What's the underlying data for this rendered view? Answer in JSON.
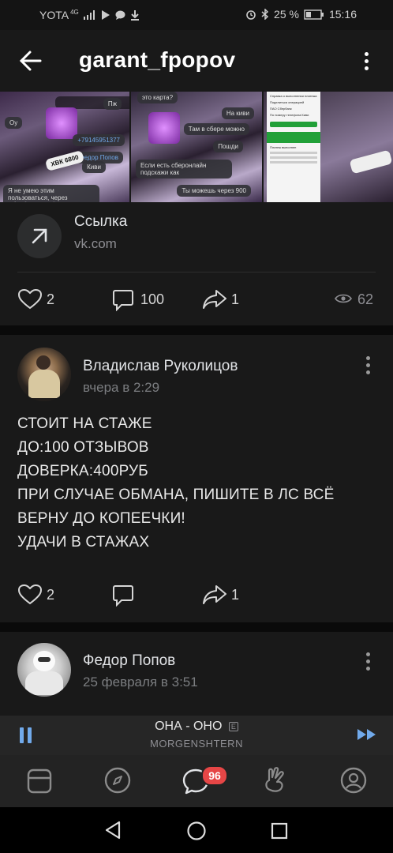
{
  "status_bar": {
    "carrier": "YOTA",
    "network": "4G",
    "battery": "25 %",
    "time": "15:16"
  },
  "header": {
    "title": "garant_fpopov",
    "back_icon": "arrow-left-icon",
    "more_icon": "more-vertical-icon"
  },
  "gallery": {
    "image1": {
      "bubbles": [
        "Пж",
        "Оу",
        "+79145951377",
        "Федор Попов",
        "Киви",
        "Я не умею этим пользоваться, через Сбербанк онлайн могу?"
      ],
      "plate": "ХВК 6800"
    },
    "image2": {
      "bubbles": [
        "это карта?",
        "На киви",
        "Там в сбере можно",
        "Пошди",
        "Если есть сберонлайн подскажи как",
        "Ты можешь через 900"
      ]
    },
    "image3": {
      "rows": [
        "Справка о выполнении платежа",
        "Поделиться операцией",
        "ПАО Сбербанк",
        "По номеру телефона Киви",
        "Платеж выполнен"
      ]
    }
  },
  "link": {
    "title": "Ссылка",
    "domain": "vk.com",
    "icon": "arrow-up-right-icon"
  },
  "post1_actions": {
    "likes": "2",
    "comments": "100",
    "shares": "1",
    "views": "62"
  },
  "post2": {
    "author": "Владислав Руколицов",
    "date": "вчера в 2:29",
    "text_lines": [
      "СТОИТ НА СТАЖЕ",
      "ДО:100 ОТЗЫВОВ",
      "ДОВЕРКА:400РУБ",
      "ПРИ СЛУЧАЕ ОБМАНА, ПИШИТЕ В ЛС ВСЁ",
      "ВЕРНУ ДО КОПЕЕЧКИ!",
      "УДАЧИ В СТАЖАХ"
    ],
    "likes": "2",
    "shares": "1"
  },
  "post3": {
    "author": "Федор Попов",
    "date": "25 февраля в 3:51"
  },
  "player": {
    "track": "ОНА - ОНО",
    "explicit": "E",
    "artist": "MORGENSHTERN"
  },
  "tabbar": {
    "messages_badge": "96"
  },
  "colors": {
    "accent": "#71aaeb",
    "badge": "#e64646",
    "card_bg": "#191919",
    "page_bg": "#0a0a0a"
  }
}
